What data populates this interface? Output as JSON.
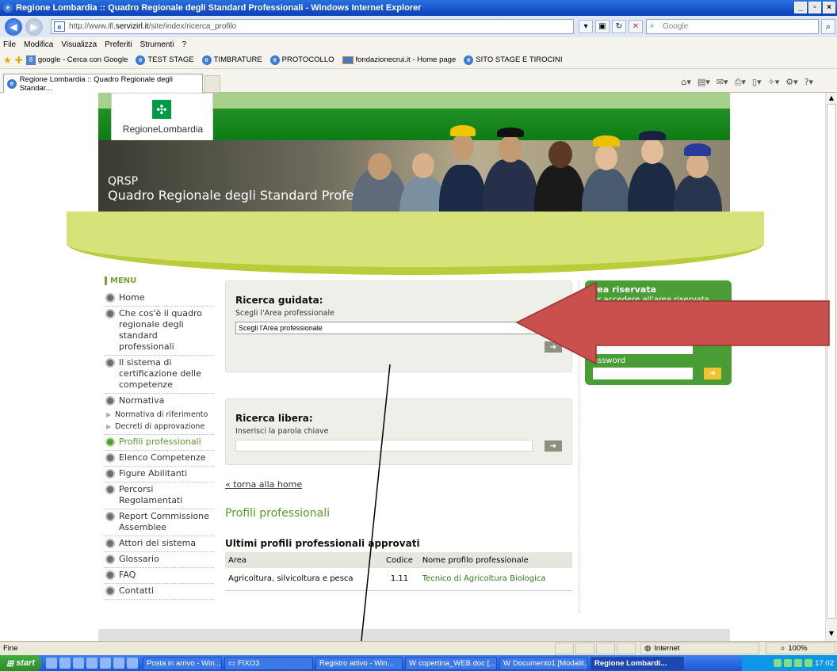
{
  "window": {
    "title": "Regione Lombardia :: Quadro Regionale degli Standard Professionali - Windows Internet Explorer",
    "controls": [
      "_",
      "▫",
      "×"
    ]
  },
  "address_bar": {
    "url_prefix": "http://www.ifl.",
    "url_domain": "servizirl.it",
    "url_suffix": "/site/index/ricerca_profilo",
    "search_placeholder": "Google"
  },
  "menu_bar": [
    "File",
    "Modifica",
    "Visualizza",
    "Preferiti",
    "Strumenti",
    "?"
  ],
  "favorites": [
    {
      "label": "google - Cerca con Google",
      "icon": "google-icon"
    },
    {
      "label": "TEST STAGE",
      "icon": "ie-icon"
    },
    {
      "label": "TIMBRATURE",
      "icon": "ie-icon"
    },
    {
      "label": "PROTOCOLLO",
      "icon": "ie-icon"
    },
    {
      "label": "fondazionecrui.it - Home page",
      "icon": "crui-icon"
    },
    {
      "label": "SITO STAGE E TIROCINI",
      "icon": "ie-icon"
    }
  ],
  "tab": {
    "label": "Regione Lombardia :: Quadro Regionale degli Standar..."
  },
  "site": {
    "logo_text": "RegioneLombardia",
    "banner_line1": "QRSP",
    "banner_line2": "Quadro Regionale degli Standard Professionali",
    "menu_title": "MENU",
    "menu": [
      {
        "label": "Home"
      },
      {
        "label": "Che cos'è il quadro regionale degli standard professionali"
      },
      {
        "label": "Il sistema di certificazione delle competenze"
      },
      {
        "label": "Normativa"
      }
    ],
    "submenu": [
      "Normativa di riferimento",
      "Decreti di approvazione"
    ],
    "menu2": [
      {
        "label": "Profili professionali",
        "active": true
      },
      {
        "label": "Elenco Competenze"
      },
      {
        "label": "Figure Abilitanti"
      },
      {
        "label": "Percorsi Regolamentati"
      },
      {
        "label": "Report Commissione Assemblee"
      },
      {
        "label": "Attori del sistema"
      },
      {
        "label": "Glossario"
      },
      {
        "label": "FAQ"
      },
      {
        "label": "Contatti"
      }
    ],
    "guided_search": {
      "title": "Ricerca guidata:",
      "label": "Scegli l'Area professionale",
      "select_value": "Scegli l'Area professionale"
    },
    "free_search": {
      "title": "Ricerca libera:",
      "label": "Inserisci la parola chiave"
    },
    "reserved_area": {
      "title": "rea riservata",
      "desc": "er accedere all'area riservata",
      "password_label": "assword"
    },
    "back_link": "« torna alla home",
    "page_title": "Profili professionali",
    "latest_title": "Ultimi profili professionali approvati",
    "table": {
      "headers": [
        "Area",
        "Codice",
        "Nome profilo professionale"
      ],
      "rows": [
        [
          "Agricoltura, silvicoltura e pesca",
          "1.11",
          "Tecnico di Agricoltura Biologica"
        ]
      ]
    }
  },
  "status_bar": {
    "left": "Fine",
    "zone": "Internet",
    "zoom": "100%"
  },
  "taskbar": {
    "start": "start",
    "items": [
      {
        "label": "Posta in arrivo - Win..."
      },
      {
        "label": "FIXO3"
      },
      {
        "label": "Registro attivo - Win..."
      },
      {
        "label": "copertina_WEB.doc [..."
      },
      {
        "label": "Documento1 [Modalit..."
      },
      {
        "label": "Regione Lombardi...",
        "active": true
      }
    ],
    "clock": "17.02"
  },
  "colors": {
    "site_green": "#0c7d14",
    "accent_green": "#5a9a28",
    "arrow_red": "#c9504d"
  }
}
